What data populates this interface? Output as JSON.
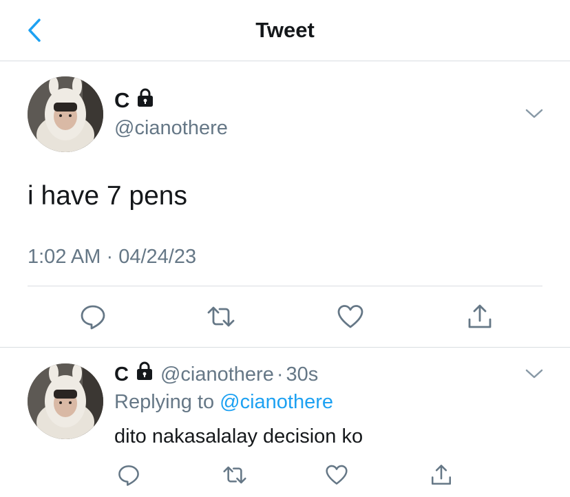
{
  "header": {
    "title": "Tweet",
    "back_icon": "chevron-left-icon",
    "accent": "#1da1f2"
  },
  "tweet": {
    "name": "C",
    "lock_icon": "lock-icon",
    "handle": "@cianothere",
    "text": "i have 7 pens",
    "time": "1:02 AM",
    "separator": "·",
    "date": "04/24/23",
    "actions": [
      "reply-icon",
      "retweet-icon",
      "like-icon",
      "share-icon"
    ]
  },
  "reply": {
    "name": "C",
    "handle": "@cianothere",
    "separator": "·",
    "time": "30s",
    "replying_to_label": "Replying to",
    "replying_to_handle": "@cianothere",
    "text": "dito nakasalalay decision ko",
    "actions": [
      "reply-icon",
      "retweet-icon",
      "like-icon",
      "share-icon"
    ]
  },
  "colors": {
    "text": "#14171a",
    "secondary": "#657786",
    "link": "#1da1f2",
    "divider": "#d9dde1"
  }
}
